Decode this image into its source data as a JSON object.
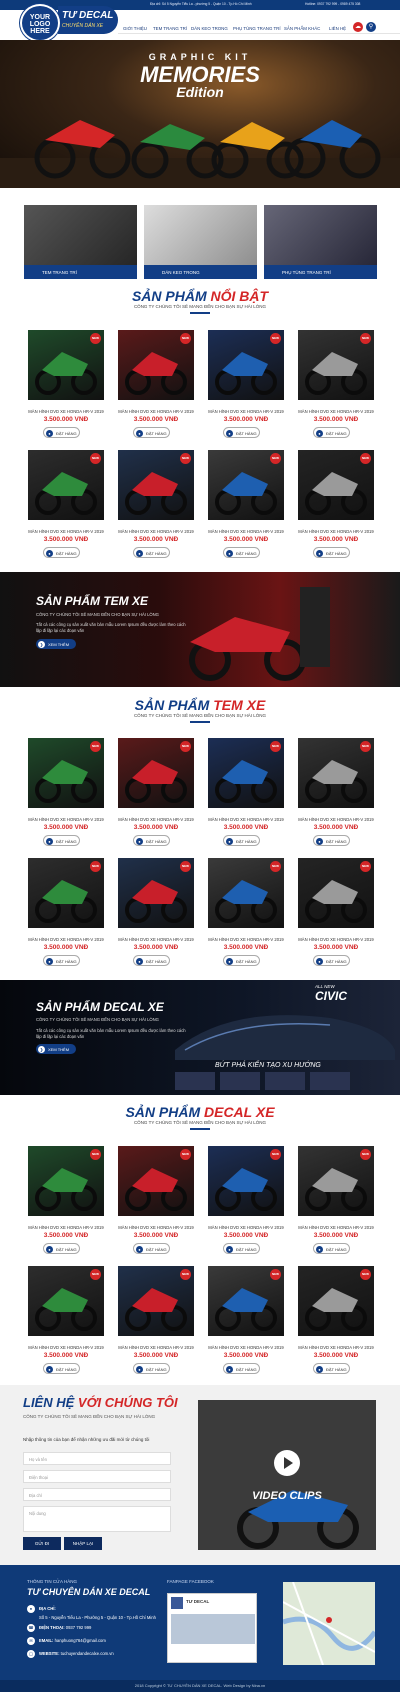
{
  "header": {
    "address": "Địa chỉ: Số 5 Nguyễn Tiểu La - phường 5 - Quận 10 - Tp.Hồ Chí Minh",
    "hotline": "Hotline: 0937 792 999 - 0989 475 308",
    "logo": [
      "YOUR",
      "LOGO",
      "HERE"
    ],
    "brand_title": "TƯ DECAL",
    "brand_subtitle": "CHUYÊN DÁN XE",
    "nav": [
      "GIỚI THIỆU",
      "TEM TRANG TRÍ",
      "DÁN KEO TRONG",
      "PHỤ TÙNG TRANG TRÍ",
      "SẢN PHẨM KHÁC",
      "LIÊN HỆ"
    ]
  },
  "hero": {
    "line1": "GRAPHIC KIT",
    "line2": "MEMORIES",
    "line3": "Edition"
  },
  "categories": [
    "TEM TRANG TRÍ",
    "DÁN KEO TRONG",
    "PHỤ TÙNG TRANG TRÍ"
  ],
  "sections": [
    {
      "title_a": "SẢN PHẨM",
      "title_b": "NỔI BẬT",
      "subtitle": "CÔNG TY CHÚNG TÔI SẼ MANG ĐẾN CHO BẠN SỰ HÀI LÒNG"
    },
    {
      "title_a": "SẢN PHẨM",
      "title_b": "TEM XE",
      "subtitle": "CÔNG TY CHÚNG TÔI SẼ MANG ĐẾN CHO BẠN SỰ HÀI LÒNG"
    },
    {
      "title_a": "SẢN PHẨM",
      "title_b": "DECAL XE",
      "subtitle": "CÔNG TY CHÚNG TÔI SẼ MANG ĐẾN CHO BẠN SỰ HÀI LÒNG"
    }
  ],
  "product": {
    "name": "MÀN HÌNH DVD XE HONDA HR-V 2019",
    "price": "3.500.000 VNĐ",
    "button": "ĐẶT HÀNG",
    "badge": "NEW"
  },
  "banners": [
    {
      "title": "SẢN PHẨM TEM XE",
      "subtitle": "CÔNG TY CHÚNG TÔI SẼ MANG ĐẾN CHO BẠN SỰ HÀI LÒNG",
      "desc": "Tất cả các công cụ sản xuất văn bản mẫu Lorem Ipsum đều được làm theo cách lặp đi lặp lại các đoạn văn",
      "button": "XEM THÊM"
    },
    {
      "title": "SẢN PHẨM DECAL XE",
      "subtitle": "CÔNG TY CHÚNG TÔI SẼ MANG ĐẾN CHO BẠN SỰ HÀI LÒNG",
      "desc": "Tất cả các công cụ sản xuất văn bản mẫu Lorem Ipsum đều được làm theo cách lặp đi lặp lại các đoạn văn",
      "button": "XEM THÊM",
      "brand1": "ALL NEW",
      "brand2": "CIVIC",
      "slogan": "BỨT PHÁ KIẾN TẠO XU HƯỚNG"
    }
  ],
  "contact": {
    "title_a": "LIÊN HỆ",
    "title_b": "VỚI CHÚNG TÔI",
    "subtitle": "CÔNG TY CHÚNG TÔI SẼ MANG ĐẾN CHO BẠN SỰ HÀI LÒNG",
    "note": "Nhập thông tin của bạn để nhận những ưu đãi mới từ chúng tôi",
    "fields": [
      "Họ và tên",
      "Điện thoại",
      "Địa chỉ",
      "Nội dung"
    ],
    "send": "GỬI ĐI",
    "reset": "NHẬP LẠI",
    "video": "VIDEO CLIPS"
  },
  "footer": {
    "heading": "THÔNG TIN CỬA HÀNG",
    "brand": "TƯ CHUYÊN DÁN XE DECAL",
    "addr_label": "ĐỊA CHỈ:",
    "addr": "Số 5 - Nguyễn Tiểu La - Phường 5 - Quận 10 - Tp.Hồ Chí Minh",
    "phone_label": "ĐIỆN THOẠI:",
    "phone": "0937 792 999",
    "email_label": "EMAIL:",
    "email": "hanphuong764@gmail.com",
    "web_label": "WEBSITE:",
    "web": "tuchuyendandecalxe.com.vn",
    "fanpage": "FANPAGE FACEBOOK",
    "fb_name": "TƯ DECAL",
    "copyright": "2018 Copyright © TƯ CHUYÊN DÁN XE DECAL. Web Design by Nina.vn"
  },
  "colors": {
    "primary": "#123e86",
    "accent": "#d42627"
  }
}
